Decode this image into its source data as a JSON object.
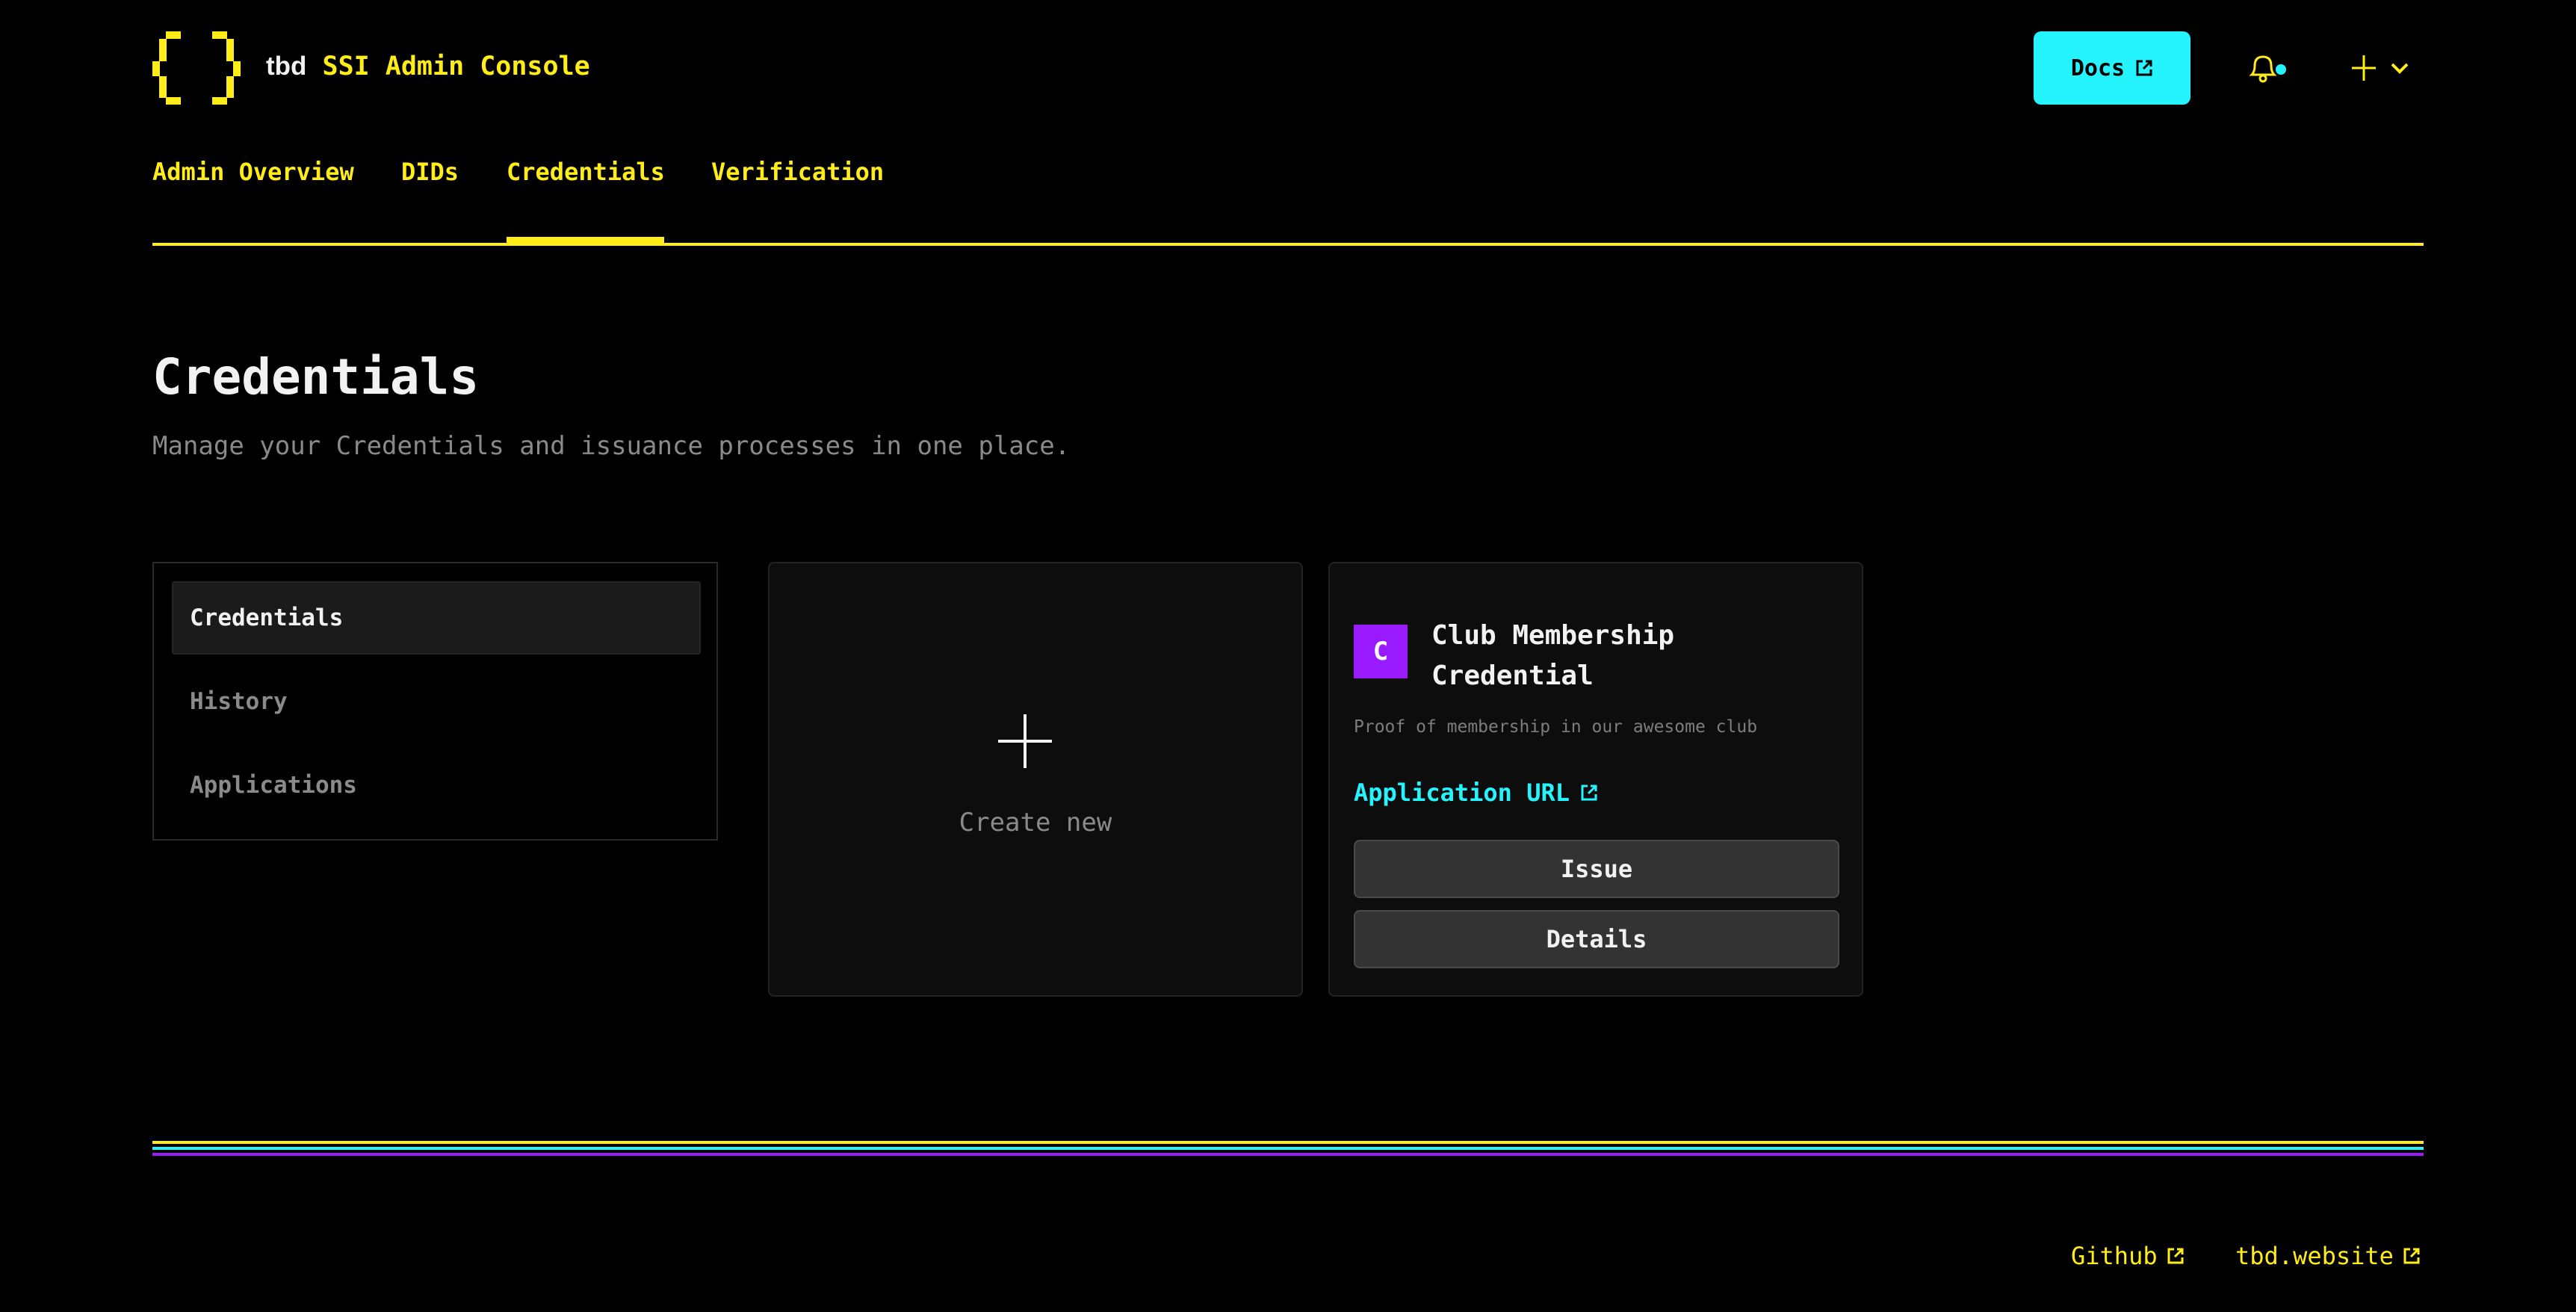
{
  "header": {
    "logo_icon": "pixel-braces-logo",
    "brand_prefix": "tbd",
    "app_name": "SSI Admin Console",
    "docs_label": "Docs",
    "docs_icon": "external-link-icon",
    "notification_icon": "bell-icon",
    "notification_badge_color": "#25f4ff",
    "create_menu_icon": "plus-icon",
    "create_menu_chevron": "chevron-down-icon"
  },
  "nav": {
    "tabs": [
      {
        "label": "Admin Overview",
        "active": false
      },
      {
        "label": "DIDs",
        "active": false
      },
      {
        "label": "Credentials",
        "active": true
      },
      {
        "label": "Verification",
        "active": false
      }
    ]
  },
  "page": {
    "title": "Credentials",
    "subtitle": "Manage your Credentials and issuance processes in one place."
  },
  "sidebar": {
    "items": [
      {
        "label": "Credentials",
        "active": true
      },
      {
        "label": "History",
        "active": false
      },
      {
        "label": "Applications",
        "active": false
      }
    ]
  },
  "create_card": {
    "icon": "plus-icon",
    "label": "Create new"
  },
  "credentials": [
    {
      "avatar_letter": "C",
      "avatar_color": "#9a1aff",
      "name": "Club Membership Credential",
      "description": "Proof of membership in our awesome club",
      "application_url_label": "Application URL",
      "issue_label": "Issue",
      "details_label": "Details"
    }
  ],
  "footer": {
    "stripe_colors": [
      "#ffec19",
      "#25f4ff",
      "#9a1aff"
    ],
    "links": [
      {
        "label": "Github",
        "icon": "external-link-icon"
      },
      {
        "label": "tbd.website",
        "icon": "external-link-icon"
      }
    ]
  },
  "theme": {
    "accent_yellow": "#ffec19",
    "accent_cyan": "#25f4ff",
    "accent_purple": "#9a1aff",
    "background": "#000000"
  }
}
